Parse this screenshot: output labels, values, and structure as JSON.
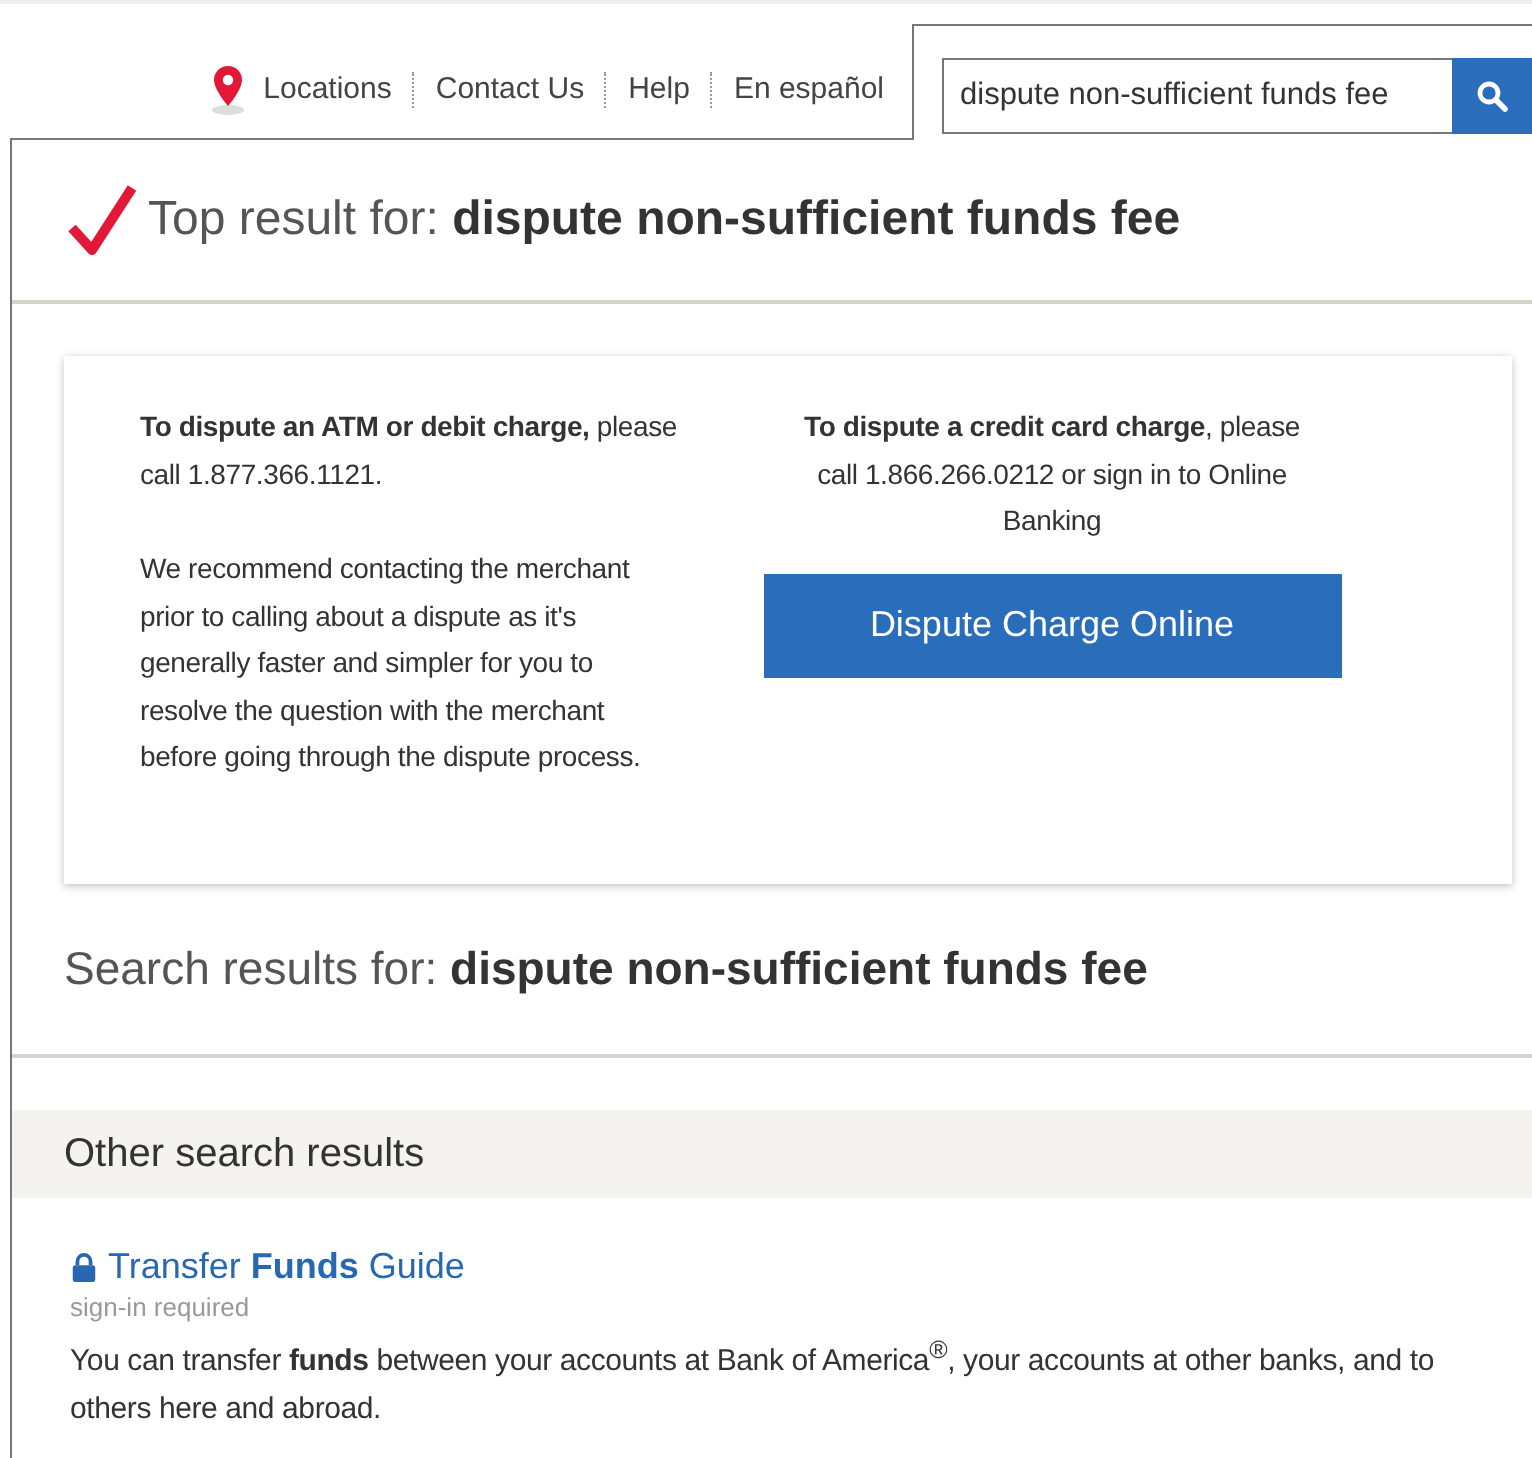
{
  "nav": {
    "links": [
      "Locations",
      "Contact Us",
      "Help",
      "En español"
    ]
  },
  "search": {
    "value": "dispute non-sufficient funds fee"
  },
  "top_result": {
    "label": "Top result for:",
    "query": "dispute non-sufficient funds fee"
  },
  "card": {
    "left": [
      "**To dispute an ATM or debit charge,** please call 1.877.366.1121.",
      "We recommend contacting the merchant prior to calling about a dispute as it's generally faster and simpler for you to resolve the question with the merchant before going through the dispute process."
    ],
    "right": "**To dispute a credit card charge**, please call 1.866.266.0212 or sign in to Online Banking",
    "button": "Dispute Charge Online"
  },
  "search_results": {
    "label": "Search results for:",
    "query": "dispute non-sufficient funds fee"
  },
  "other_results": {
    "heading": "Other search results",
    "items": [
      {
        "title": "Transfer **Funds** Guide",
        "note": "sign-in required",
        "snippet": "You can transfer **funds** between your accounts at Bank of America$^{®}$, your accounts at other banks, and to others here and abroad."
      }
    ]
  }
}
